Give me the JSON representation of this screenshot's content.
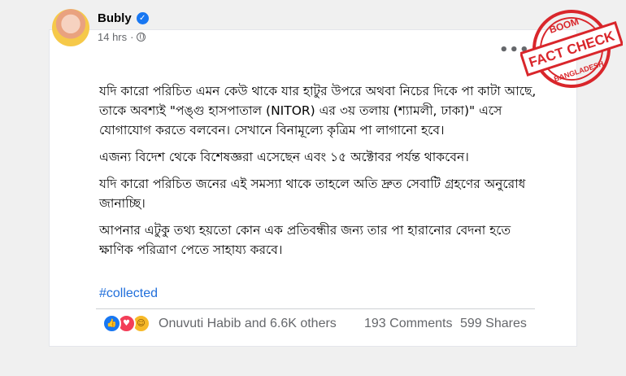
{
  "post": {
    "author": "Bubly",
    "time": "14 hrs",
    "more_icon": "more-options-icon",
    "paragraphs": [
      "যদি কারো পরিচিত এমন কেউ থাকে যার হাটুর উপরে অথবা নিচের দিকে পা কাটা আছে, তাকে অবশ্যই \"পঙ্গু হাসপাতাল (NITOR) এর ৩য় তলায় (শ্যামলী, ঢাকা)\" এসে যোগাযোগ করতে বলবেন। সেখানে বিনামূল্যে কৃত্রিম পা লাগানো হবে।",
      "এজন্য বিদেশ থেকে বিশেষজ্ঞরা এসেছেন এবং ১৫ অক্টোবর পর্যন্ত থাকবেন।",
      "যদি কারো পরিচিত জনের এই সমস্যা থাকে তাহলে অতি দ্রুত সেবাটি গ্রহণের অনুরোধ জানাচ্ছি।",
      "আপনার এটুকু তথ্য হয়তো কোন এক প্রতিবন্ধীর জন্য তার পা হারানোর বেদনা হতে ক্ষাণিক পরিত্রাণ পেতে সাহায্য করবে।"
    ],
    "hashtag": "#collected",
    "reactions_text": "Onuvuti Habib and 6.6K others",
    "comments": "193 Comments",
    "shares": "599 Shares"
  },
  "stamp": {
    "top": "BOOM",
    "middle": "FACT CHECK",
    "bottom": "BANGLADESH",
    "color": "#d9262b"
  },
  "colors": {
    "link": "#216fdb",
    "like": "#1877f2",
    "love": "#f33e58",
    "care": "#f7b928"
  }
}
